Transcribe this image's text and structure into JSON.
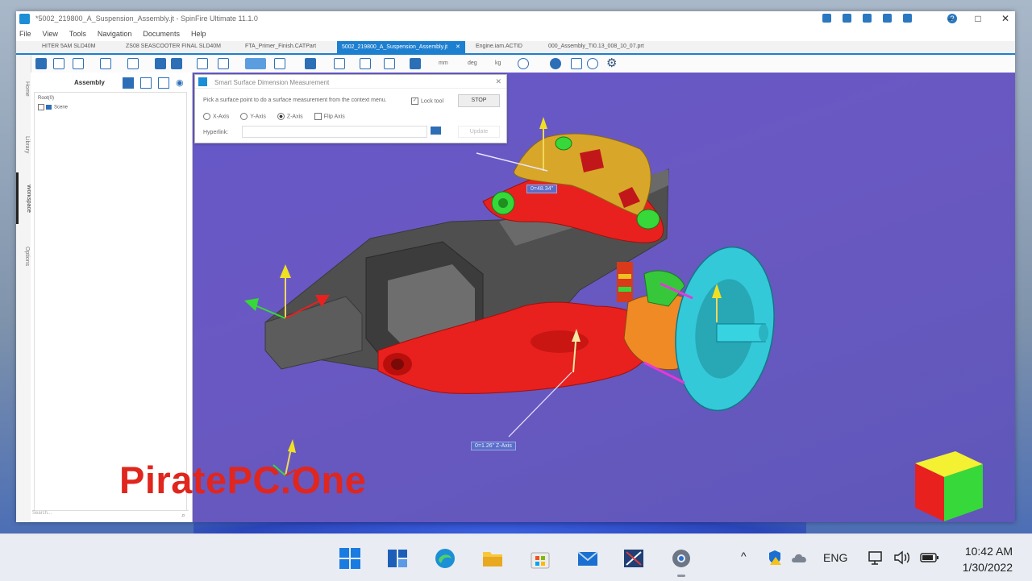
{
  "window": {
    "title": "*5002_219800_A_Suspension_Assembly.jt - SpinFire Ultimate 11.1.0"
  },
  "menu": [
    "File",
    "View",
    "Tools",
    "Navigation",
    "Documents",
    "Help"
  ],
  "doc_tabs": [
    {
      "label": "HITER 5AM SLD40M",
      "active": false
    },
    {
      "label": "ZS08 SEASCOOTER FINAL SLD40M",
      "active": false
    },
    {
      "label": "FTA_Primer_Finish.CATPart",
      "active": false
    },
    {
      "label": "5002_219800_A_Suspension_Assembly.jt",
      "active": true
    },
    {
      "label": "Engine.iam.ACTID",
      "active": false
    },
    {
      "label": "000_Assembly_TI0.13_008_10_07.prt",
      "active": false
    }
  ],
  "toolbar": {
    "units": [
      "mm",
      "deg",
      "kg"
    ]
  },
  "side_tabs": [
    "Home",
    "Library",
    "Workspace",
    "Options"
  ],
  "panel": {
    "title": "Assembly",
    "tree_root": "Root(0)",
    "tree_scene": "Scene",
    "search_placeholder": "Search..."
  },
  "dialog": {
    "title": "Smart Surface Dimension Measurement",
    "instruction": "Pick a surface point to do a surface measurement from the context menu.",
    "lock_tool": "Lock tool",
    "stop": "STOP",
    "axes": [
      "X-Axis",
      "Y-Axis",
      "Z-Axis"
    ],
    "selected_axis": "Z-Axis",
    "flip_axis": "Flip Axis",
    "hyperlink_label": "Hyperlink:",
    "update": "Update"
  },
  "measurements": {
    "upper": "0=48.34\"",
    "lower": "0=1.26\" Z-Axis"
  },
  "watermark": "PiratePC.One",
  "taskbar": {
    "language": "ENG",
    "time": "10:42 AM",
    "date": "1/30/2022"
  },
  "colors": {
    "viewport": "#6558c9",
    "accent": "#1d7fd0",
    "part_red": "#e8211e",
    "part_gray": "#5c5c5c",
    "part_yellow": "#d8a72a",
    "part_cyan": "#34c9d8",
    "part_orange": "#f08a25",
    "watermark": "#e0261d"
  }
}
